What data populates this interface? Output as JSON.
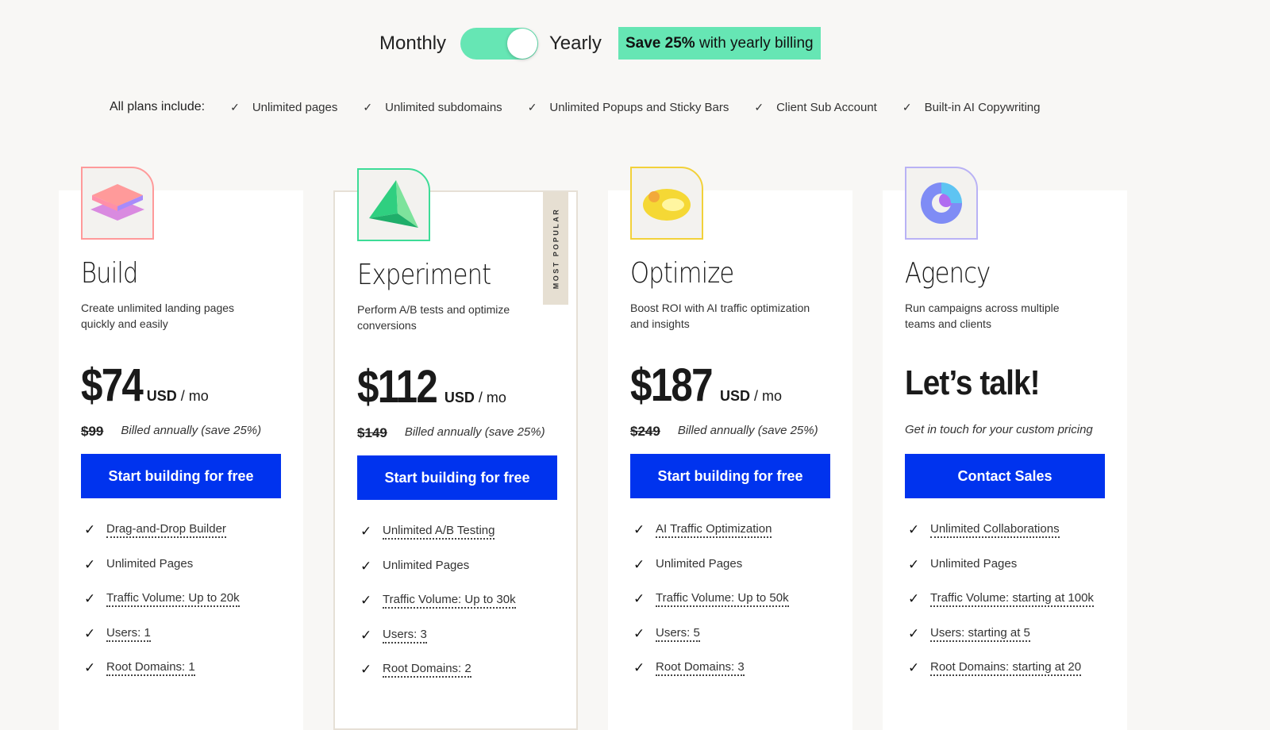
{
  "billing_toggle": {
    "monthly": "Monthly",
    "yearly": "Yearly",
    "state": "yearly",
    "save_bold": "Save 25%",
    "save_rest": " with yearly billing",
    "accent": "#66e6b4"
  },
  "includes": {
    "title": "All plans include:",
    "items": [
      "Unlimited pages",
      "Unlimited subdomains",
      "Unlimited Popups and Sticky Bars",
      "Client Sub Account",
      "Built-in AI Copywriting"
    ]
  },
  "plans": [
    {
      "name": "Build",
      "desc": "Create unlimited landing pages quickly and easily",
      "price": "$74",
      "currency": "USD",
      "period": " / mo",
      "old": "$99",
      "billing": "Billed annually (save 25%)",
      "cta": "Start building for free",
      "icon": "layers-icon",
      "color": "#ff9a9a",
      "features": [
        [
          "Drag-and-Drop Builder",
          true
        ],
        [
          "Unlimited Pages",
          false
        ],
        [
          "Traffic Volume: Up to 20k",
          true
        ],
        [
          "Users: 1",
          true
        ],
        [
          "Root Domains: 1",
          true
        ]
      ]
    },
    {
      "name": "Experiment",
      "desc": "Perform A/B tests and optimize conversions",
      "badge": "MOST POPULAR",
      "price": "$112",
      "currency": "USD",
      "period": " / mo",
      "old": "$149",
      "billing": "Billed annually (save 25%)",
      "cta": "Start building for free",
      "icon": "pyramid-icon",
      "color": "#3ddc97",
      "features": [
        [
          "Unlimited A/B Testing",
          true
        ],
        [
          "Unlimited Pages",
          false
        ],
        [
          "Traffic Volume: Up to 30k",
          true
        ],
        [
          "Users: 3",
          true
        ],
        [
          "Root Domains: 2",
          true
        ]
      ]
    },
    {
      "name": "Optimize",
      "desc": "Boost ROI with AI traffic optimization and insights",
      "price": "$187",
      "currency": "USD",
      "period": " / mo",
      "old": "$249",
      "billing": "Billed annually (save 25%)",
      "cta": "Start building for free",
      "icon": "disc-icon",
      "color": "#f2d13a",
      "features": [
        [
          "AI Traffic Optimization",
          true
        ],
        [
          "Unlimited Pages",
          false
        ],
        [
          "Traffic Volume: Up to 50k",
          true
        ],
        [
          "Users: 5",
          true
        ],
        [
          "Root Domains: 3",
          true
        ]
      ]
    },
    {
      "name": "Agency",
      "desc": "Run campaigns across multiple teams and clients",
      "headline": "Let’s talk!",
      "custom": "Get in touch for your custom pricing",
      "cta": "Contact Sales",
      "icon": "orbit-icon",
      "color": "#b9b2f5",
      "features": [
        [
          "Unlimited Collaborations",
          true
        ],
        [
          "Unlimited Pages",
          false
        ],
        [
          "Traffic Volume: starting at 100k",
          true
        ],
        [
          "Users: starting at 5",
          true
        ],
        [
          "Root Domains: starting at 20",
          true
        ]
      ]
    }
  ],
  "check": "✓"
}
